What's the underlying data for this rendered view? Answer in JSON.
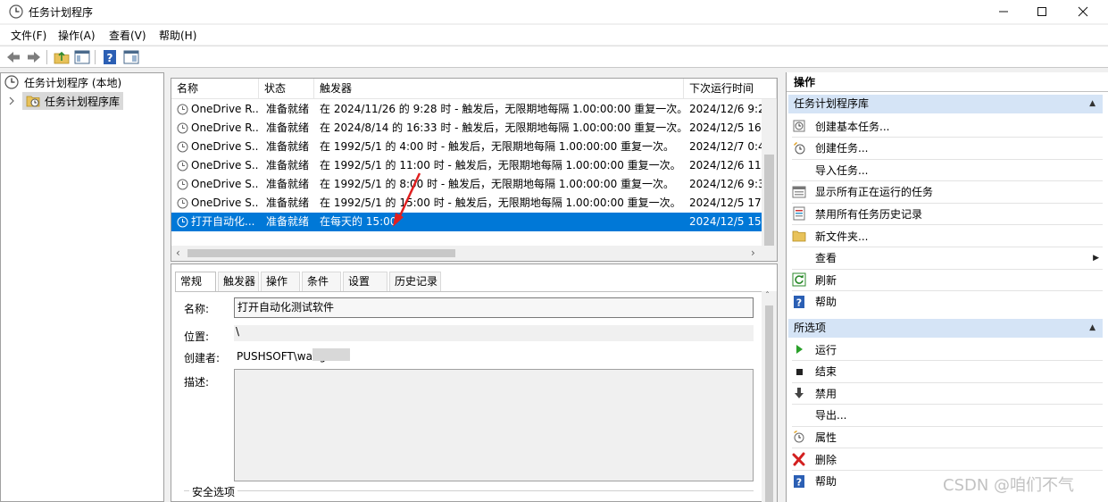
{
  "window": {
    "title": "任务计划程序",
    "minimize_icon": "minimize-icon",
    "maximize_icon": "maximize-icon",
    "close_icon": "close-icon"
  },
  "menu": [
    "文件(F)",
    "操作(A)",
    "查看(V)",
    "帮助(H)"
  ],
  "tree": {
    "root": "任务计划程序 (本地)",
    "library": "任务计划程序库"
  },
  "task_list": {
    "columns": [
      "名称",
      "状态",
      "触发器",
      "下次运行时间"
    ],
    "rows": [
      {
        "name": "OneDrive R...",
        "status": "准备就绪",
        "trigger": "在 2024/11/26 的 9:28 时 - 触发后，无限期地每隔 1.00:00:00 重复一次。",
        "next": "2024/12/6 9:2"
      },
      {
        "name": "OneDrive R...",
        "status": "准备就绪",
        "trigger": "在 2024/8/14 的 16:33 时 - 触发后，无限期地每隔 1.00:00:00 重复一次。",
        "next": "2024/12/5 16:"
      },
      {
        "name": "OneDrive S...",
        "status": "准备就绪",
        "trigger": "在 1992/5/1 的 4:00 时 - 触发后，无限期地每隔 1.00:00:00 重复一次。",
        "next": "2024/12/7 0:4"
      },
      {
        "name": "OneDrive S...",
        "status": "准备就绪",
        "trigger": "在 1992/5/1 的 11:00 时 - 触发后，无限期地每隔 1.00:00:00 重复一次。",
        "next": "2024/12/6 11:"
      },
      {
        "name": "OneDrive S...",
        "status": "准备就绪",
        "trigger": "在 1992/5/1 的 8:00 时 - 触发后，无限期地每隔 1.00:00:00 重复一次。",
        "next": "2024/12/6 9:3"
      },
      {
        "name": "OneDrive S...",
        "status": "准备就绪",
        "trigger": "在 1992/5/1 的 15:00 时 - 触发后，无限期地每隔 1.00:00:00 重复一次。",
        "next": "2024/12/5 17:"
      },
      {
        "name": "打开自动化...",
        "status": "准备就绪",
        "trigger": "在每天的 15:00",
        "next": "2024/12/5 15:"
      }
    ],
    "selected_row": 6
  },
  "details": {
    "tabs": [
      "常规",
      "触发器",
      "操作",
      "条件",
      "设置",
      "历史记录"
    ],
    "active_tab": 0,
    "name_label": "名称:",
    "name_value": "打开自动化测试软件",
    "location_label": "位置:",
    "location_value": "\\",
    "author_label": "创建者:",
    "author_value": "PUSHSOFT\\wang",
    "desc_label": "描述:",
    "desc_value": "",
    "security_label": "安全选项"
  },
  "actions": {
    "title": "操作",
    "section1": {
      "title": "任务计划程序库",
      "items": [
        {
          "label": "创建基本任务...",
          "icon": "create-basic-task-icon"
        },
        {
          "label": "创建任务...",
          "icon": "create-task-icon"
        },
        {
          "label": "导入任务...",
          "icon": ""
        },
        {
          "label": "显示所有正在运行的任务",
          "icon": "running-tasks-icon"
        },
        {
          "label": "禁用所有任务历史记录",
          "icon": "history-icon"
        },
        {
          "label": "新文件夹...",
          "icon": "folder-icon"
        },
        {
          "label": "查看",
          "icon": ""
        },
        {
          "label": "刷新",
          "icon": "refresh-icon"
        },
        {
          "label": "帮助",
          "icon": "help-icon"
        }
      ]
    },
    "section2": {
      "title": "所选项",
      "items": [
        {
          "label": "运行",
          "icon": "run-icon"
        },
        {
          "label": "结束",
          "icon": "stop-icon"
        },
        {
          "label": "禁用",
          "icon": "disable-icon"
        },
        {
          "label": "导出...",
          "icon": ""
        },
        {
          "label": "属性",
          "icon": "properties-icon"
        },
        {
          "label": "删除",
          "icon": "delete-icon"
        },
        {
          "label": "帮助",
          "icon": "help-icon"
        }
      ]
    }
  },
  "watermark": "CSDN @咱们不气",
  "colors": {
    "selection": "#0078d7",
    "section_header": "#d5e4f6",
    "annotation_arrow": "#e02020"
  }
}
